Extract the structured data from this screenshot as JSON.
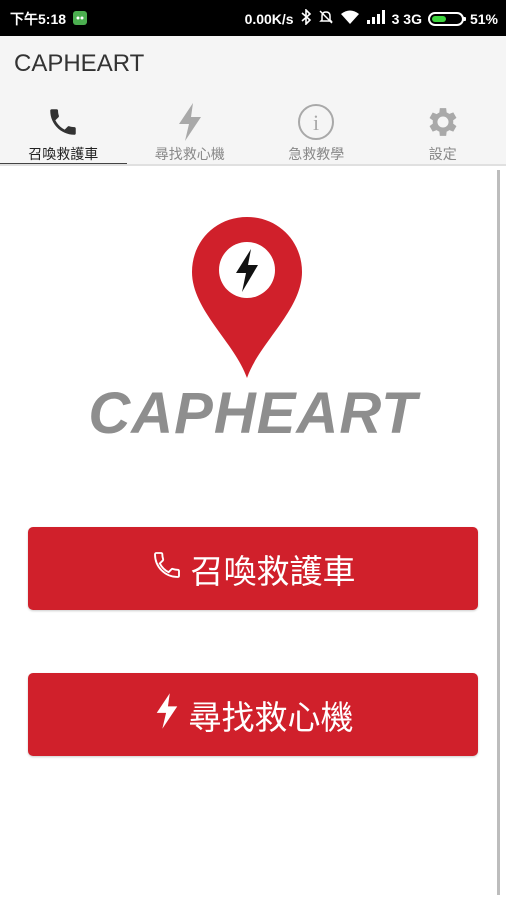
{
  "status_bar": {
    "time": "下午5:18",
    "speed": "0.00K/s",
    "network": "3 3G",
    "battery": "51%",
    "battery_level": 0.51
  },
  "app": {
    "title": "CAPHEART",
    "logo_text": "CAPHEART"
  },
  "tabs": [
    {
      "label": "召喚救護車",
      "icon": "phone-icon",
      "active": true
    },
    {
      "label": "尋找救心機",
      "icon": "lightning-icon",
      "active": false
    },
    {
      "label": "急救教學",
      "icon": "info-icon",
      "active": false
    },
    {
      "label": "設定",
      "icon": "gear-icon",
      "active": false
    }
  ],
  "buttons": {
    "call_ambulance": "召喚救護車",
    "find_aed": "尋找救心機"
  },
  "colors": {
    "brand_red": "#d0202b",
    "logo_gray": "#8e8e8e",
    "battery_green": "#3dd43d"
  }
}
